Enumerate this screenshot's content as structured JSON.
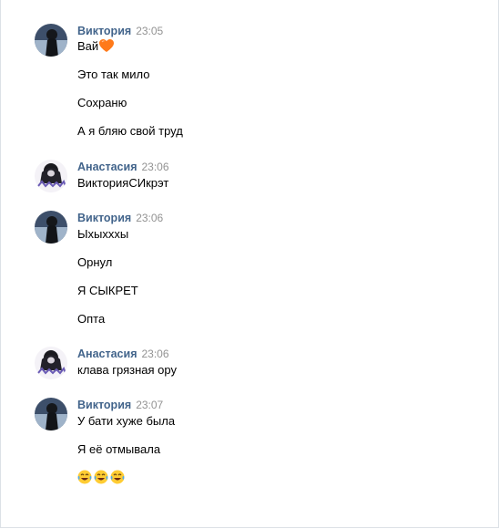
{
  "groups": [
    {
      "author": "Виктория",
      "time": "23:05",
      "avatar": "viktoria-avatar",
      "lines": [
        "Вай",
        "Это так мило",
        "Сохраню",
        "А я бляю свой труд"
      ]
    },
    {
      "author": "Анастасия",
      "time": "23:06",
      "avatar": "anastasia-avatar",
      "lines": [
        "ВикторияСИкрэт"
      ]
    },
    {
      "author": "Виктория",
      "time": "23:06",
      "avatar": "viktoria-avatar",
      "lines": [
        "Ыхыхххы",
        "Орнул",
        "Я СЫКРЕТ",
        "Опта"
      ]
    },
    {
      "author": "Анастасия",
      "time": "23:06",
      "avatar": "anastasia-avatar",
      "lines": [
        "клава грязная ору"
      ]
    },
    {
      "author": "Виктория",
      "time": "23:07",
      "avatar": "viktoria-avatar",
      "lines": [
        "У бати хуже была",
        "Я её отмывала"
      ]
    }
  ],
  "icons": {
    "heart": "orange-heart-emoji-icon",
    "laugh": "tears-of-joy-emoji-icon"
  },
  "colors": {
    "author": "#42648b",
    "time": "#939393",
    "text": "#000000"
  }
}
